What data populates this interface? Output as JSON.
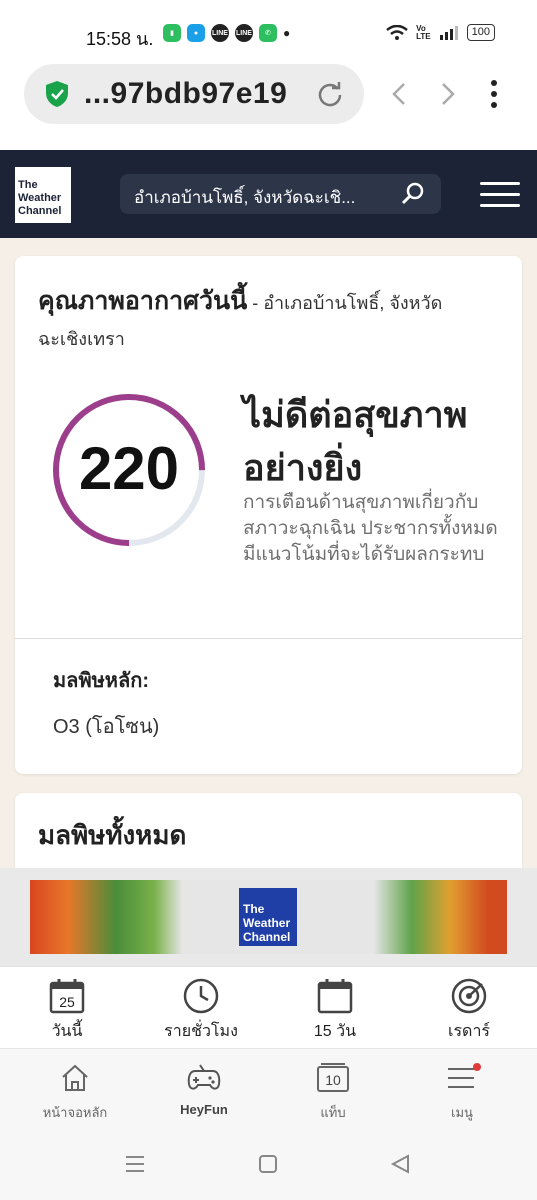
{
  "status_bar": {
    "time": "15:58 น.",
    "battery": "100"
  },
  "browser": {
    "url": "...97bdb97e19"
  },
  "header": {
    "logo_text": "The Weather Channel",
    "search_text": "อำเภอบ้านโพธิ์, จังหวัดฉะเชิ..."
  },
  "aqi_card": {
    "title": "คุณภาพอากาศวันนี้",
    "location": " - อำเภอบ้านโพธิ์, จังหวัดฉะเชิงเทรา",
    "value": "220",
    "gauge_fraction": 0.75,
    "gauge_color": "#9c3e8c",
    "category": "ไม่ดีต่อสุขภาพอย่างยิ่ง",
    "description": "การเตือนด้านสุขภาพเกี่ยวกับสภาวะฉุกเฉิน ประชากรทั้งหมดมีแนวโน้มที่จะได้รับผลกระทบ",
    "pollutant_label": "มลพิษหลัก:",
    "pollutant_value": "O3 (โอโซน)"
  },
  "all_pollutants": {
    "title": "มลพิษทั้งหมด"
  },
  "ad": {
    "logo_text": "The Weather Channel"
  },
  "tabs": [
    {
      "label": "วันนี้",
      "icon": "calendar-icon",
      "day": "25"
    },
    {
      "label": "รายชั่วโมง",
      "icon": "clock-icon"
    },
    {
      "label": "15 วัน",
      "icon": "calendar-icon"
    },
    {
      "label": "เรดาร์",
      "icon": "radar-icon"
    }
  ],
  "browser_nav": [
    {
      "label": "หน้าจอหลัก",
      "icon": "home-icon"
    },
    {
      "label": "HeyFun",
      "icon": "gamepad-icon"
    },
    {
      "label": "แท็บ",
      "icon": "tabs-icon",
      "count": "10"
    },
    {
      "label": "เมนู",
      "icon": "menu-icon"
    }
  ]
}
